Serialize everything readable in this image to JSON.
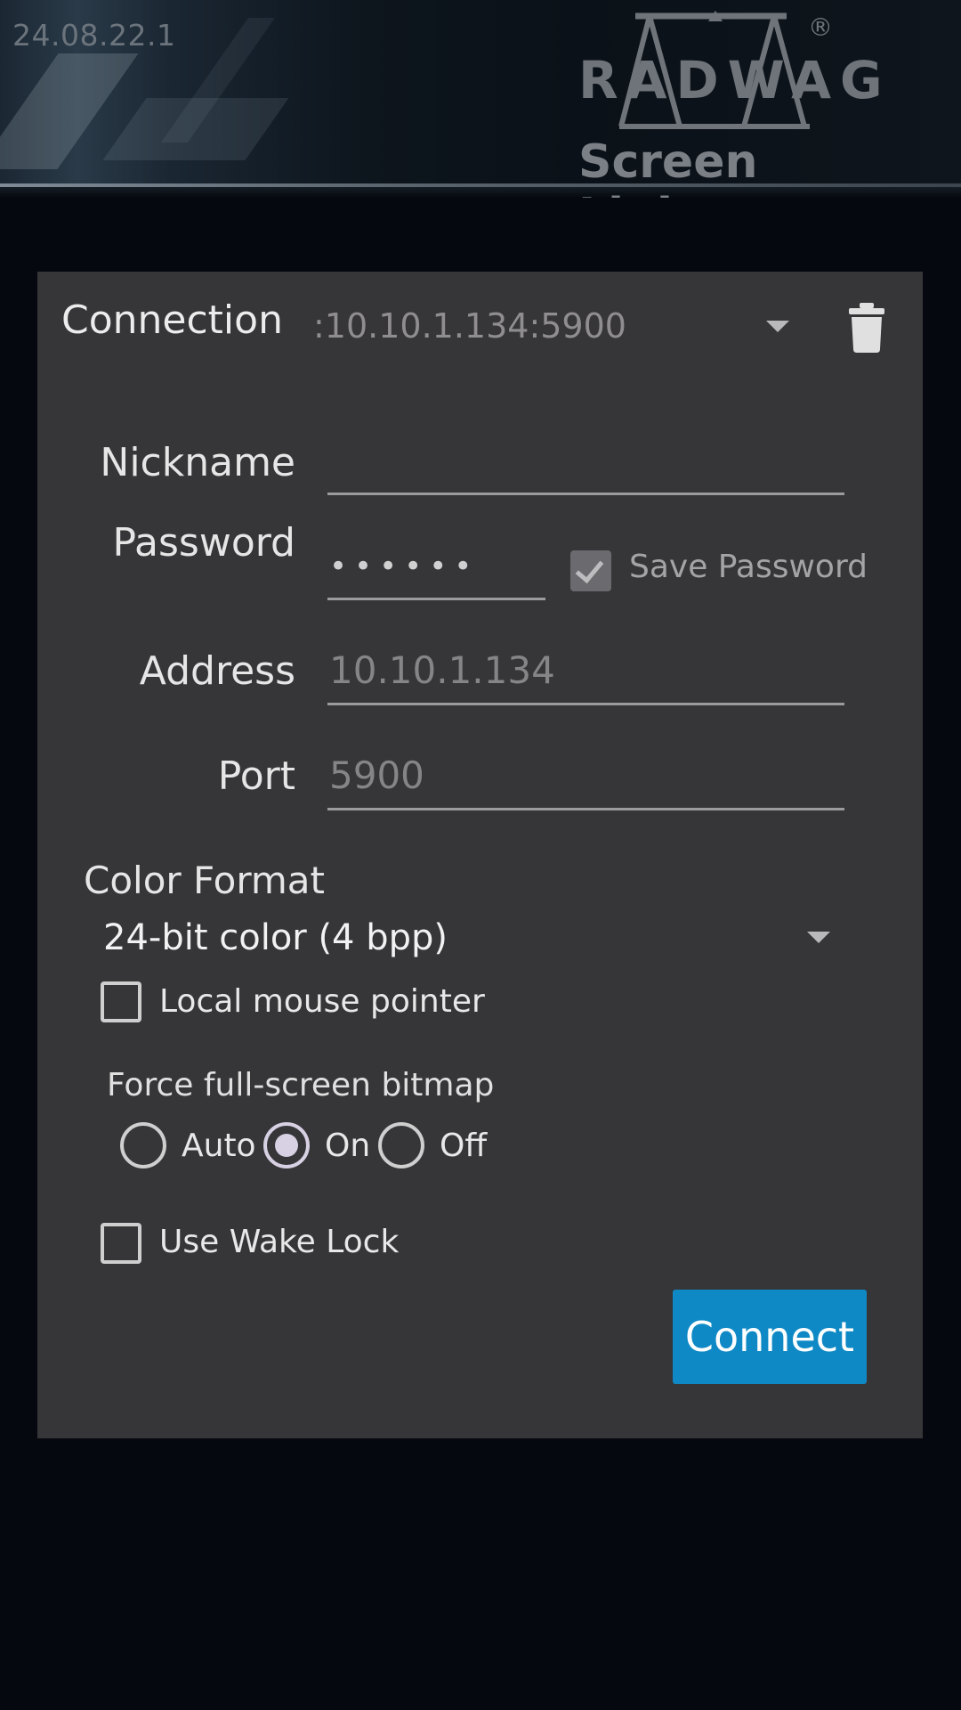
{
  "header": {
    "version": "24.08.22.1",
    "logo_word": "RADWAG",
    "logo_sub": "Screen Link",
    "logo_reg": "®"
  },
  "connection": {
    "label": "Connection",
    "value": ":10.10.1.134:5900",
    "dropdown_icon": "chevron-down-icon",
    "delete_icon": "trash-icon"
  },
  "form": {
    "nickname_label": "Nickname",
    "nickname_value": "",
    "password_label": "Password",
    "password_value": "••••••",
    "save_password_label": "Save Password",
    "save_password_checked": true,
    "address_label": "Address",
    "address_placeholder": "10.10.1.134",
    "port_label": "Port",
    "port_placeholder": "5900"
  },
  "color_format": {
    "title": "Color Format",
    "selected": "24-bit color (4 bpp)"
  },
  "options": {
    "local_mouse_label": "Local mouse pointer",
    "local_mouse_checked": false,
    "force_bitmap_title": "Force full-screen bitmap",
    "force_bitmap_options": [
      "Auto",
      "On",
      "Off"
    ],
    "force_bitmap_selected": "On",
    "wake_lock_label": "Use Wake Lock",
    "wake_lock_checked": false
  },
  "actions": {
    "connect_label": "Connect"
  },
  "colors": {
    "background": "#05090f",
    "card": "#363538",
    "accent": "#0f89c6"
  }
}
